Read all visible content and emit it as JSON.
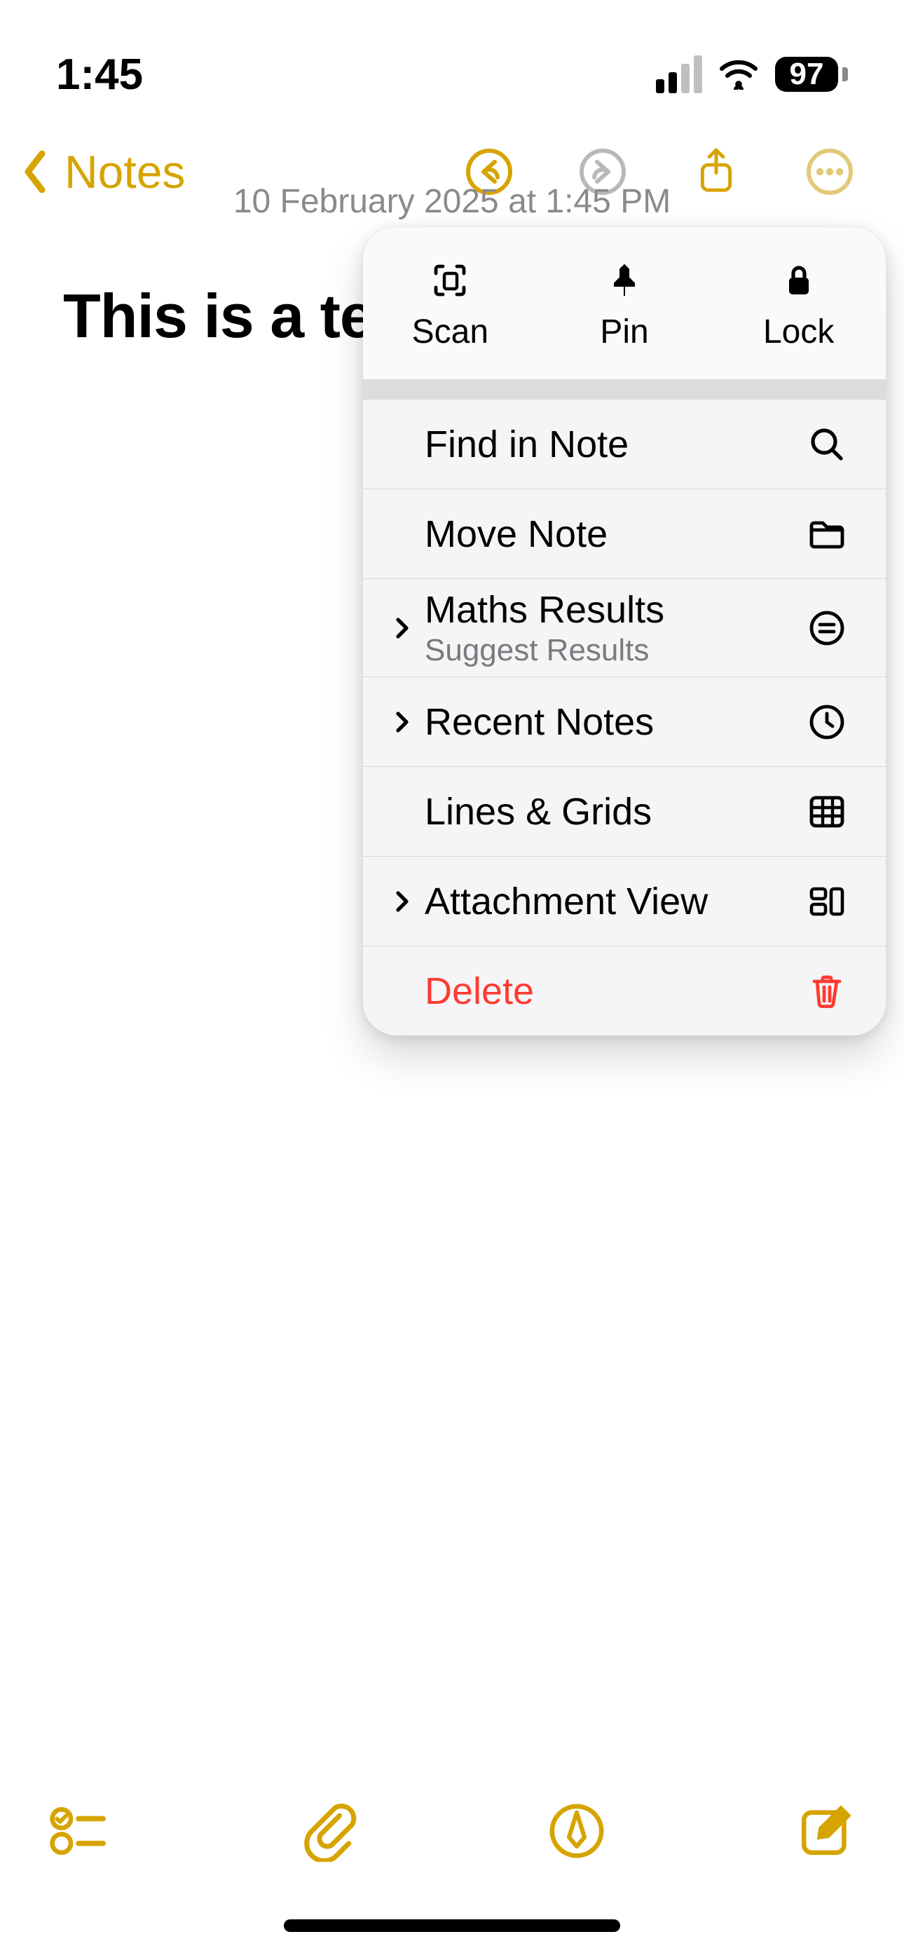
{
  "status": {
    "time": "1:45",
    "battery_pct": "97"
  },
  "nav": {
    "back_label": "Notes"
  },
  "note": {
    "date_line": "10 February 2025 at 1:45 PM",
    "title": "This is a tes"
  },
  "popover": {
    "quick": {
      "scan": "Scan",
      "pin": "Pin",
      "lock": "Lock"
    },
    "items": {
      "find": "Find in Note",
      "move": "Move Note",
      "maths": {
        "label": "Maths Results",
        "sub": "Suggest Results"
      },
      "recent": "Recent Notes",
      "lines": "Lines & Grids",
      "attach": "Attachment View",
      "delete": "Delete"
    }
  },
  "colors": {
    "accent": "#d6a400",
    "destructive": "#ff3b30"
  }
}
